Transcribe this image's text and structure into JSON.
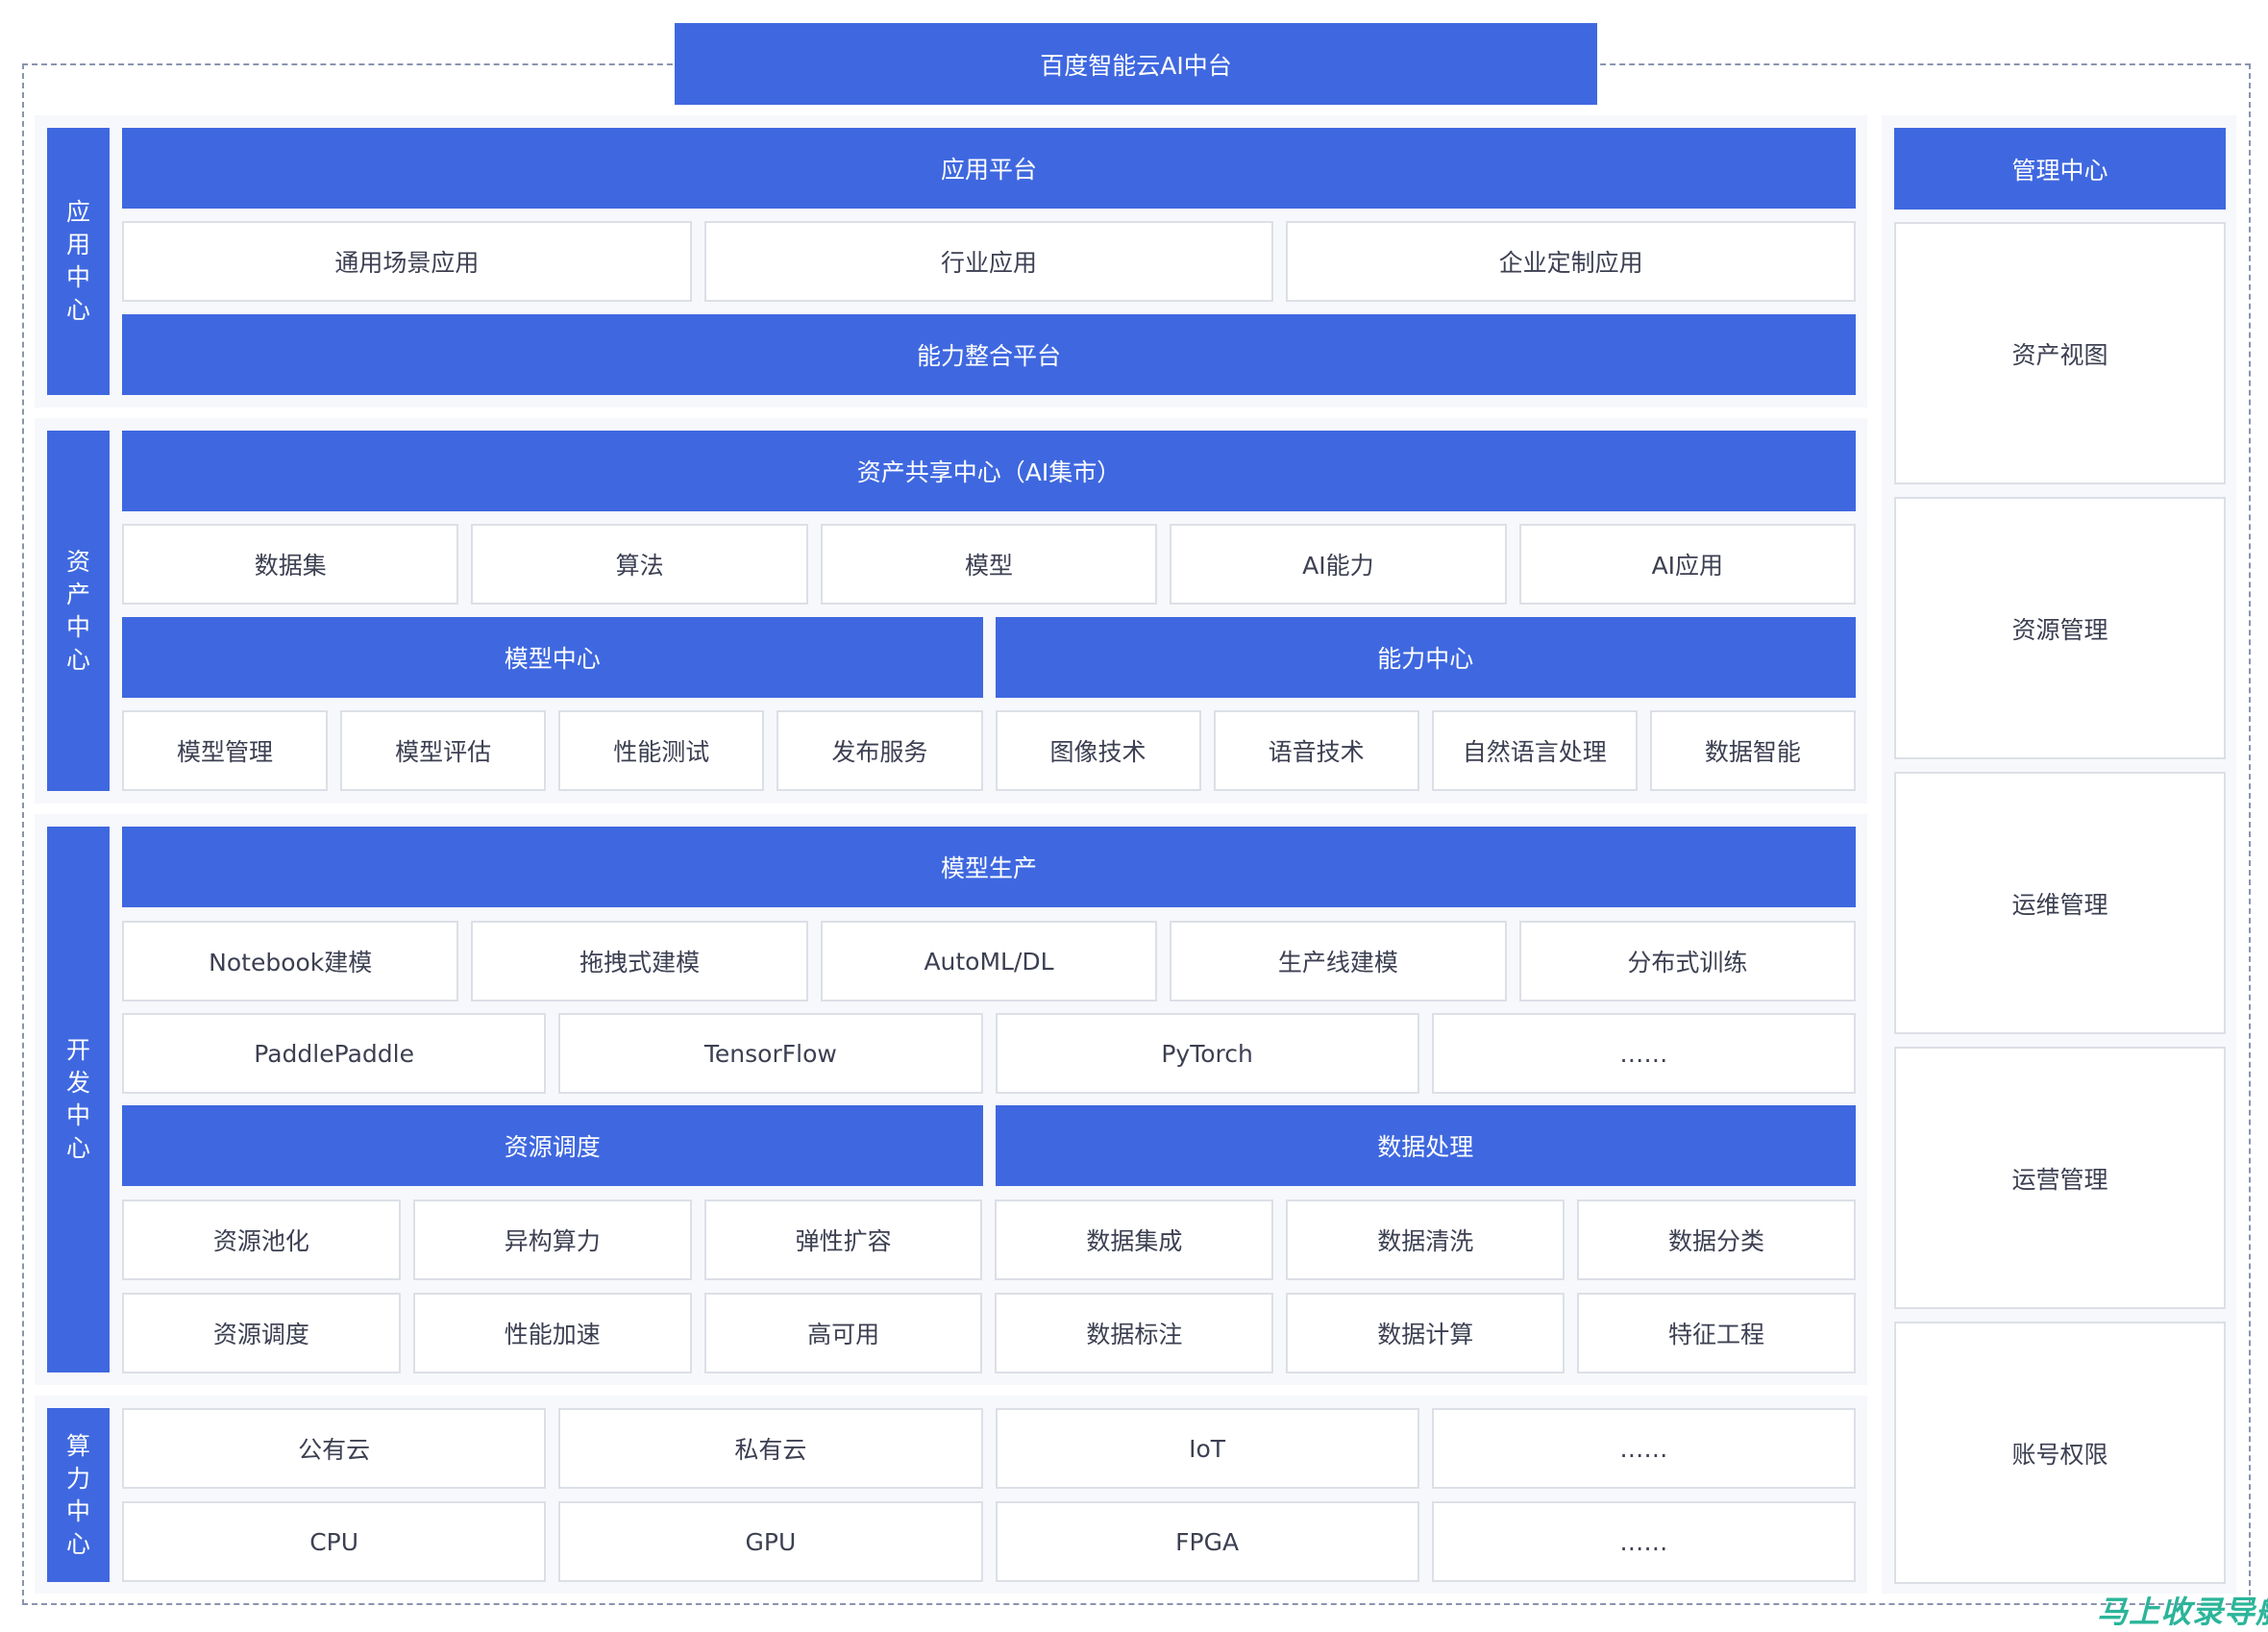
{
  "title": "百度智能云AI中台",
  "sections": {
    "app_center": {
      "label": "应用中心",
      "rows": [
        {
          "type": "blue",
          "items": [
            "应用平台"
          ]
        },
        {
          "type": "white",
          "items": [
            "通用场景应用",
            "行业应用",
            "企业定制应用"
          ]
        },
        {
          "type": "blue",
          "items": [
            "能力整合平台"
          ]
        }
      ]
    },
    "asset_center": {
      "label": "资产中心",
      "rows": [
        {
          "type": "blue",
          "items": [
            "资产共享中心（AI集市）"
          ]
        },
        {
          "type": "white",
          "items": [
            "数据集",
            "算法",
            "模型",
            "AI能力",
            "AI应用"
          ]
        },
        {
          "type": "blue",
          "items": [
            "模型中心",
            "能力中心"
          ]
        },
        {
          "type": "white",
          "items": [
            "模型管理",
            "模型评估",
            "性能测试",
            "发布服务",
            "图像技术",
            "语音技术",
            "自然语言处理",
            "数据智能"
          ]
        }
      ]
    },
    "dev_center": {
      "label": "开发中心",
      "rows": [
        {
          "type": "blue",
          "items": [
            "模型生产"
          ]
        },
        {
          "type": "white",
          "items": [
            "Notebook建模",
            "拖拽式建模",
            "AutoML/DL",
            "生产线建模",
            "分布式训练"
          ]
        },
        {
          "type": "white",
          "items": [
            "PaddlePaddle",
            "TensorFlow",
            "PyTorch",
            "……"
          ]
        },
        {
          "type": "blue",
          "items": [
            "资源调度",
            "数据处理"
          ]
        },
        {
          "type": "white",
          "items": [
            "资源池化",
            "异构算力",
            "弹性扩容",
            "数据集成",
            "数据清洗",
            "数据分类"
          ]
        },
        {
          "type": "white",
          "items": [
            "资源调度",
            "性能加速",
            "高可用",
            "数据标注",
            "数据计算",
            "特征工程"
          ]
        }
      ]
    },
    "compute_center": {
      "label": "算力中心",
      "rows": [
        {
          "type": "white",
          "items": [
            "公有云",
            "私有云",
            "IoT",
            "……"
          ]
        },
        {
          "type": "white",
          "items": [
            "CPU",
            "GPU",
            "FPGA",
            "……"
          ]
        }
      ]
    }
  },
  "management_center": {
    "header": "管理中心",
    "items": [
      "资产视图",
      "资源管理",
      "运维管理",
      "运营管理",
      "账号权限"
    ]
  },
  "watermark": "马上收录导航",
  "colors": {
    "primary_blue": "#3f68e0",
    "text": "#3d4052",
    "section_bg": "#f7f8fb",
    "cell_border": "#dcdfe6",
    "watermark": "#2bb59a"
  }
}
